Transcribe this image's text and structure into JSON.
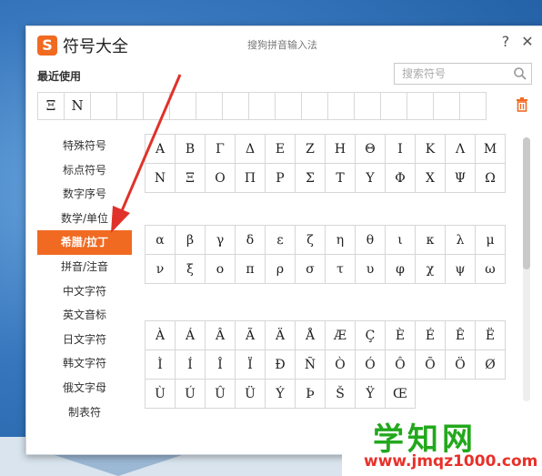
{
  "window": {
    "logo_letter": "S",
    "title": "符号大全",
    "subtitle": "搜狗拼音输入法",
    "help_glyph": "?",
    "close_glyph": "✕"
  },
  "recent": {
    "label": "最近使用",
    "items": [
      "Ξ",
      "N",
      "",
      "",
      "",
      "",
      "",
      "",
      "",
      "",
      "",
      "",
      "",
      "",
      "",
      "",
      ""
    ]
  },
  "search": {
    "placeholder": "搜索符号"
  },
  "sidebar": {
    "items": [
      {
        "label": "特殊符号"
      },
      {
        "label": "标点符号"
      },
      {
        "label": "数字序号"
      },
      {
        "label": "数学/单位"
      },
      {
        "label": "希腊/拉丁",
        "active": true
      },
      {
        "label": "拼音/注音"
      },
      {
        "label": "中文字符"
      },
      {
        "label": "英文音标"
      },
      {
        "label": "日文字符"
      },
      {
        "label": "韩文字符"
      },
      {
        "label": "俄文字母"
      },
      {
        "label": "制表符"
      }
    ]
  },
  "groups": [
    {
      "rows": [
        [
          "Α",
          "Β",
          "Γ",
          "Δ",
          "Ε",
          "Ζ",
          "Η",
          "Θ",
          "Ι",
          "Κ",
          "Λ",
          "Μ"
        ],
        [
          "Ν",
          "Ξ",
          "Ο",
          "Π",
          "Ρ",
          "Σ",
          "Τ",
          "Υ",
          "Φ",
          "Χ",
          "Ψ",
          "Ω"
        ]
      ]
    },
    {
      "rows": [
        [
          "α",
          "β",
          "γ",
          "δ",
          "ε",
          "ζ",
          "η",
          "θ",
          "ι",
          "κ",
          "λ",
          "μ"
        ],
        [
          "ν",
          "ξ",
          "ο",
          "π",
          "ρ",
          "σ",
          "τ",
          "υ",
          "φ",
          "χ",
          "ψ",
          "ω"
        ]
      ]
    },
    {
      "rows": [
        [
          "À",
          "Á",
          "Â",
          "Ã",
          "Ä",
          "Å",
          "Æ",
          "Ç",
          "È",
          "É",
          "Ê",
          "Ë"
        ],
        [
          "Ì",
          "Í",
          "Î",
          "Ï",
          "Ð",
          "Ñ",
          "Ò",
          "Ó",
          "Ô",
          "Õ",
          "Ö",
          "Ø"
        ],
        [
          "Ù",
          "Ú",
          "Û",
          "Ü",
          "Ý",
          "Þ",
          "Š",
          "Ÿ",
          "Œ",
          "",
          "",
          ""
        ]
      ]
    }
  ],
  "watermark": {
    "big": "学知网",
    "small": "www.jmqz1000.com"
  },
  "colors": {
    "accent": "#f06a22",
    "annotation_arrow": "#e0322a",
    "watermark_green": "#22a81c",
    "watermark_red": "#e8312a"
  },
  "icons": {
    "search": "search-icon",
    "trash": "trash-icon",
    "close": "close-icon",
    "help": "help-icon",
    "logo": "sogou-logo-icon"
  }
}
